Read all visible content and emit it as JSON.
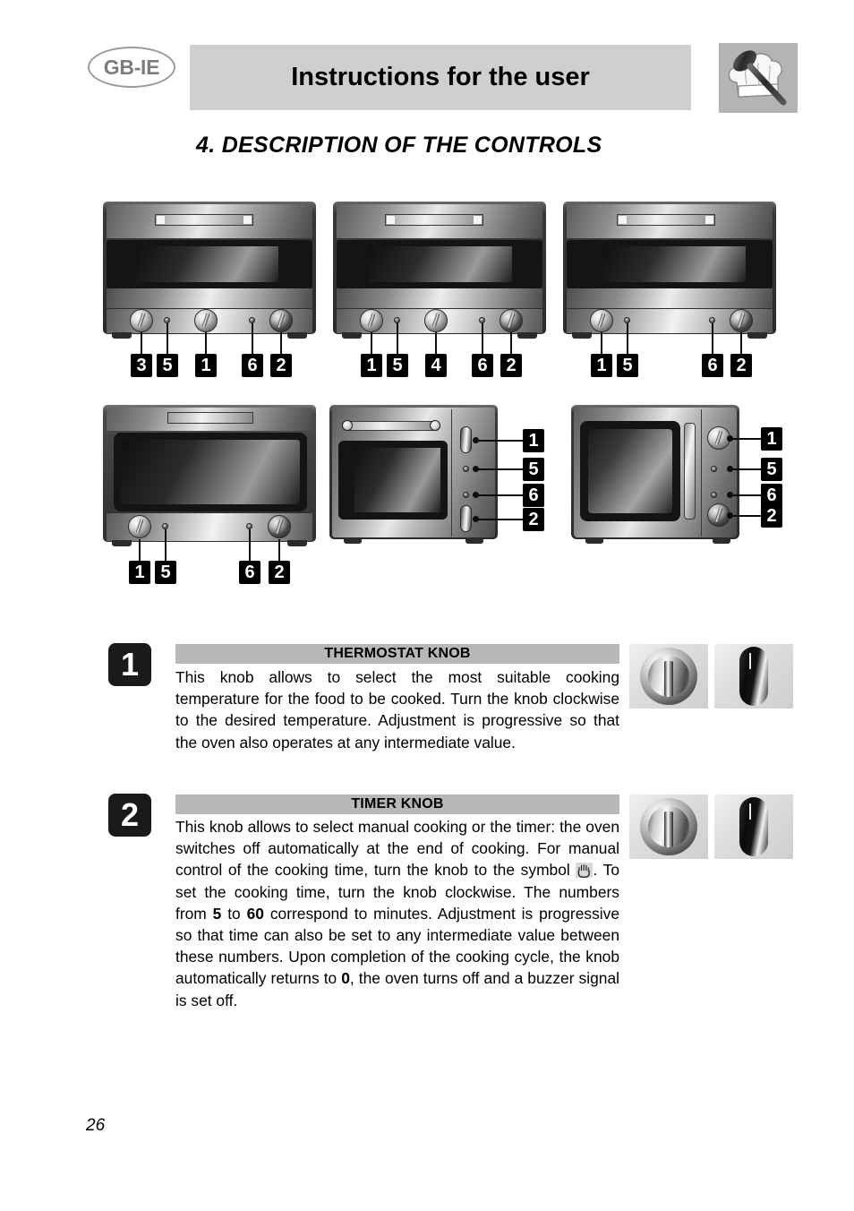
{
  "header": {
    "language_badge": "GB-IE",
    "title": "Instructions for the user",
    "logo_icon": "chef-hat-spoon-icon"
  },
  "section": {
    "title": "4.  DESCRIPTION OF THE CONTROLS"
  },
  "figures": [
    {
      "id": "oven-figure-1",
      "type": "front-controls",
      "labels": [
        "3",
        "5",
        "1",
        "6",
        "2"
      ]
    },
    {
      "id": "oven-figure-2",
      "type": "front-controls",
      "labels": [
        "1",
        "5",
        "4",
        "6",
        "2"
      ]
    },
    {
      "id": "oven-figure-3",
      "type": "front-controls",
      "labels": [
        "1",
        "5",
        "6",
        "2"
      ]
    },
    {
      "id": "oven-figure-4",
      "type": "front-controls",
      "labels": [
        "1",
        "5",
        "6",
        "2"
      ]
    },
    {
      "id": "oven-figure-5",
      "type": "side-controls",
      "labels": [
        "1",
        "5",
        "6",
        "2"
      ]
    },
    {
      "id": "oven-figure-6",
      "type": "side-controls",
      "labels": [
        "1",
        "5",
        "6",
        "2"
      ]
    }
  ],
  "descriptions": [
    {
      "badge": "1",
      "heading": "THERMOSTAT KNOB",
      "body_parts": [
        {
          "text": "This knob allows to select the most suitable cooking temperature for the food to be cooked. Turn the knob clockwise to the desired temperature. Adjustment is progressive so that the oven also operates at any intermediate value.",
          "bold": false
        }
      ]
    },
    {
      "badge": "2",
      "heading": "TIMER KNOB",
      "body_parts": [
        {
          "text": "This knob allows to select manual cooking or the timer: the oven switches off automatically at the end of cooking. For manual control of the cooking time, turn the knob to the symbol ",
          "bold": false
        },
        {
          "text": "hand-symbol-icon",
          "symbol": true
        },
        {
          "text": ". To set the cooking time, turn the knob clockwise. The numbers from ",
          "bold": false
        },
        {
          "text": "5",
          "bold": true
        },
        {
          "text": " to ",
          "bold": false
        },
        {
          "text": "60",
          "bold": true
        },
        {
          "text": " correspond to minutes. Adjustment is progressive so that time can also be set to any intermediate value between these numbers. Upon completion of the cooking cycle, the knob automatically returns to ",
          "bold": false
        },
        {
          "text": "0",
          "bold": true
        },
        {
          "text": ", the oven turns off and a buzzer signal is set off.",
          "bold": false
        }
      ]
    }
  ],
  "knob_swatches": {
    "round_knob_icon": "round-silver-knob-icon",
    "oval_knob_icon": "black-oval-knob-icon"
  },
  "footer": {
    "page_number": "26"
  },
  "colors": {
    "header_bar": "#cfcfcf",
    "section_header_bar": "#b8b8b8",
    "badge_background": "#1a1a1a",
    "badge_text": "#ffffff",
    "logo_background": "#b4b4b4"
  }
}
